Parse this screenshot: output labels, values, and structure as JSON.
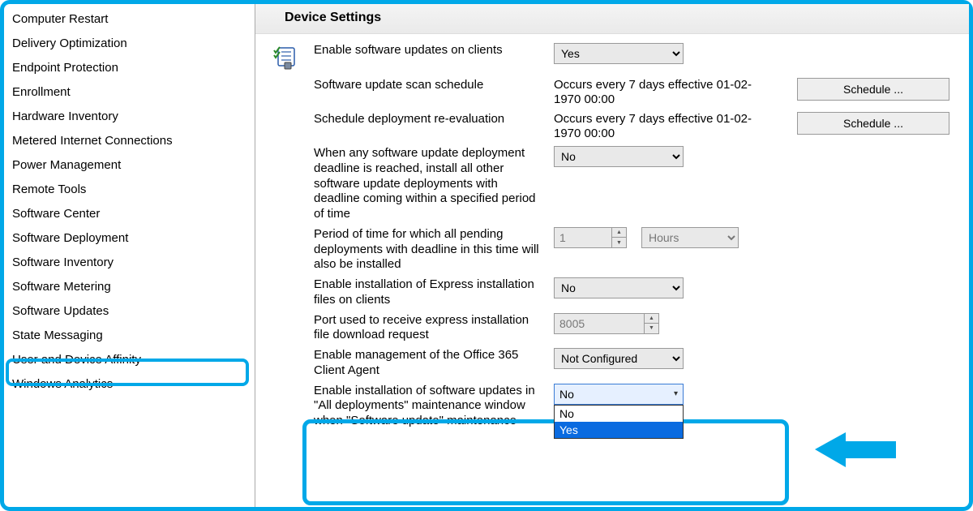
{
  "sidebar": {
    "items": [
      "Computer Restart",
      "Delivery Optimization",
      "Endpoint Protection",
      "Enrollment",
      "Hardware Inventory",
      "Metered Internet Connections",
      "Power Management",
      "Remote Tools",
      "Software Center",
      "Software Deployment",
      "Software Inventory",
      "Software Metering",
      "Software Updates",
      "State Messaging",
      "User and Device Affinity",
      "Windows Analytics"
    ],
    "selected_index": 12
  },
  "header": {
    "title": "Device Settings"
  },
  "settings": {
    "enable_updates": {
      "label": "Enable software updates on clients",
      "value": "Yes"
    },
    "scan_schedule": {
      "label": "Software update scan schedule",
      "text": "Occurs every 7 days effective 01-02-1970 00:00",
      "button": "Schedule ..."
    },
    "reeval": {
      "label": "Schedule deployment re-evaluation",
      "text": "Occurs every 7 days effective 01-02-1970 00:00",
      "button": "Schedule ..."
    },
    "deadline_install": {
      "label": "When any software update deployment deadline is reached, install all other software update deployments with deadline coming within a specified period of time",
      "value": "No"
    },
    "period": {
      "label": "Period of time for which all pending deployments with deadline in this time will also be installed",
      "value": "1",
      "unit": "Hours"
    },
    "express": {
      "label": "Enable installation of Express installation files on clients",
      "value": "No"
    },
    "port": {
      "label": "Port used to receive express installation file download request",
      "value": "8005"
    },
    "o365": {
      "label": "Enable management of the Office 365 Client Agent",
      "value": "Not Configured"
    },
    "maint_window": {
      "label": "Enable installation of software updates in \"All deployments\" maintenance window when \"Software update\" maintenance",
      "value": "No",
      "options": [
        "No",
        "Yes"
      ],
      "highlighted_option_index": 1
    }
  }
}
